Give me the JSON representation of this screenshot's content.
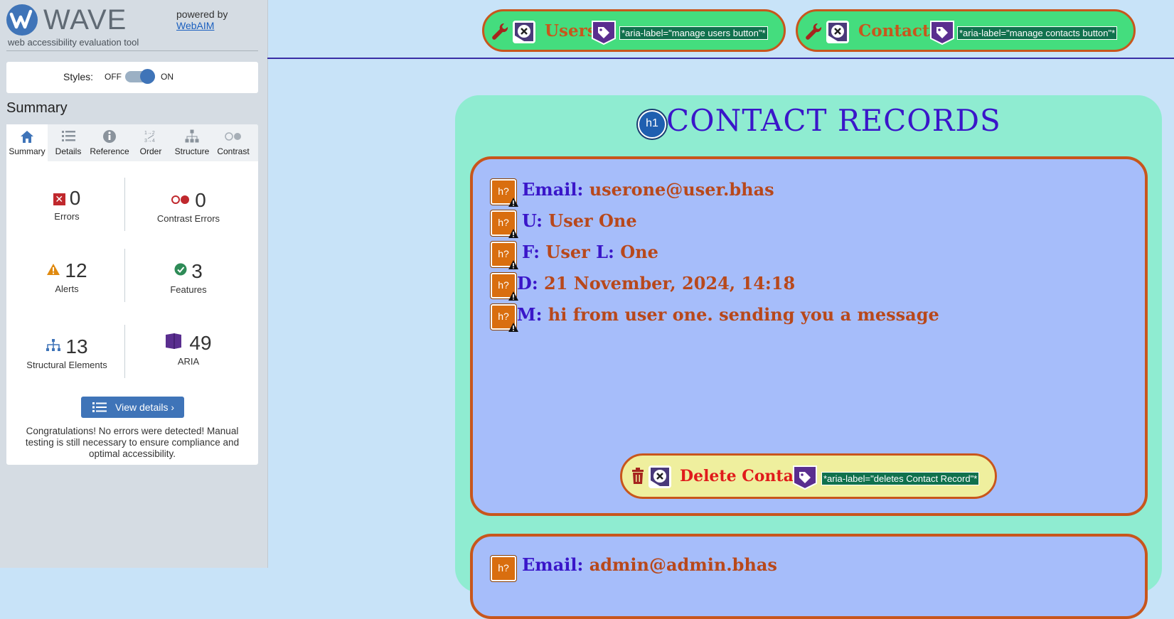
{
  "wave": {
    "logo_text": "WAVE",
    "tagline": "web accessibility evaluation tool",
    "powered_by": "powered by",
    "powered_link": "WebAIM",
    "styles_label": "Styles:",
    "styles_off": "OFF",
    "styles_on": "ON",
    "summary_title": "Summary",
    "tabs": [
      {
        "label": "Summary",
        "icon": "home-icon"
      },
      {
        "label": "Details",
        "icon": "list-icon"
      },
      {
        "label": "Reference",
        "icon": "info-icon"
      },
      {
        "label": "Order",
        "icon": "order-icon"
      },
      {
        "label": "Structure",
        "icon": "structure-icon"
      },
      {
        "label": "Contrast",
        "icon": "contrast-icon"
      }
    ],
    "stats": {
      "errors": {
        "value": "0",
        "label": "Errors"
      },
      "contrast_errors": {
        "value": "0",
        "label": "Contrast Errors"
      },
      "alerts": {
        "value": "12",
        "label": "Alerts"
      },
      "features": {
        "value": "3",
        "label": "Features"
      },
      "structural": {
        "value": "13",
        "label": "Structural Elements"
      },
      "aria": {
        "value": "49",
        "label": "ARIA"
      }
    },
    "view_details": "View details ›",
    "congrats": "Congratulations! No errors were detected! Manual testing is still necessary to ensure compliance and optimal accessibility."
  },
  "nav": {
    "users_label": "Users",
    "users_aria": "*aria-label=\"manage users button\"*",
    "contacts_label": "Contacts",
    "contacts_aria": "*aria-label=\"manage contacts button\"*"
  },
  "page": {
    "h1_badge": "h1",
    "title": "CONTACT RECORDS",
    "record": {
      "email_key": "Email:",
      "email_val": "userone@user.bhas",
      "u_key": "U:",
      "u_val": "User One",
      "f_key": "F:",
      "f_val": "User",
      "l_key": "L:",
      "l_val": "One",
      "d_key": "D:",
      "d_val": "21 November, 2024, 14:18",
      "m_key": "M:",
      "m_val": "hi from user one. sending you a message"
    },
    "hq_badge": "h?",
    "delete_label": "Delete Contact",
    "delete_aria": "*aria-label=\"deletes Contact Record\"*",
    "record2": {
      "email_key": "Email:",
      "email_val": "admin@admin.bhas"
    }
  },
  "colors": {
    "wave_blue": "#3f74b8",
    "error_red": "#c0282d",
    "alert_orange": "#e08a10",
    "feature_green": "#2e8b57",
    "aria_purple": "#5a2e8f",
    "nav_green": "#44dd7e",
    "heading_blue": "#3a16c9",
    "value_orange": "#b8481b"
  }
}
